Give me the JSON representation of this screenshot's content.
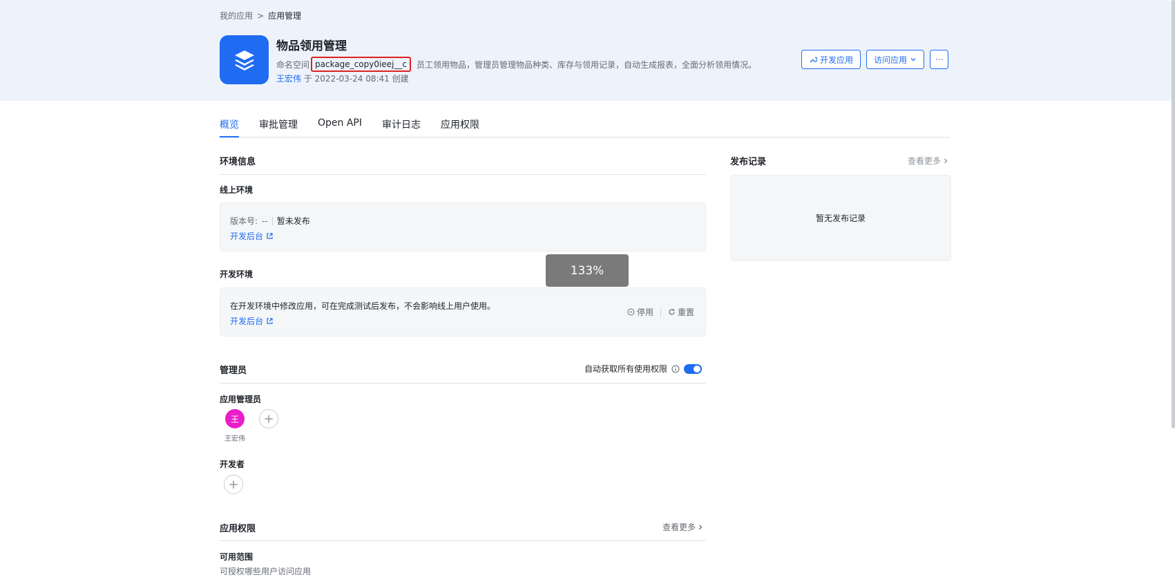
{
  "breadcrumb": {
    "root": "我的应用",
    "sep": ">",
    "current": "应用管理"
  },
  "app": {
    "title": "物品领用管理",
    "namespace_label": "命名空间",
    "namespace_value": "package_copy0ieej__c",
    "description": "员工领用物品，管理员管理物品种类、库存与领用记录，自动生成报表，全面分析领用情况。",
    "creator": "王宏伟",
    "created_text": "于 2022-03-24 08:41 创建"
  },
  "header_buttons": {
    "develop": "开发应用",
    "visit": "访问应用",
    "more": "···"
  },
  "tabs": [
    "概览",
    "审批管理",
    "Open API",
    "审计日志",
    "应用权限"
  ],
  "env": {
    "title": "环境信息",
    "online": {
      "title": "线上环境",
      "version_label": "版本号:",
      "version_value": "--",
      "status": "暂未发布",
      "console_link": "开发后台"
    },
    "dev": {
      "title": "开发环境",
      "desc": "在开发环境中修改应用，可在完成测试后发布，不会影响线上用户使用。",
      "console_link": "开发后台",
      "stop": "停用",
      "reset": "重置"
    }
  },
  "admins": {
    "title": "管理员",
    "auto_perm_label": "自动获取所有使用权限",
    "auto_perm_on": true,
    "app_admin_title": "应用管理员",
    "admin_avatar": "王",
    "admin_name": "王宏伟",
    "developer_title": "开发者"
  },
  "permissions": {
    "title": "应用权限",
    "more": "查看更多",
    "scope_title": "可用范围",
    "scope_desc": "可授权哪些用户访问应用"
  },
  "release": {
    "title": "发布记录",
    "more": "查看更多",
    "empty": "暂无发布记录"
  },
  "zoom_indicator": "133%",
  "colors": {
    "accent": "#1f6bf2",
    "header_bg": "#eef2fb",
    "highlight_border": "#e02020",
    "avatar": "#e91ec9"
  }
}
